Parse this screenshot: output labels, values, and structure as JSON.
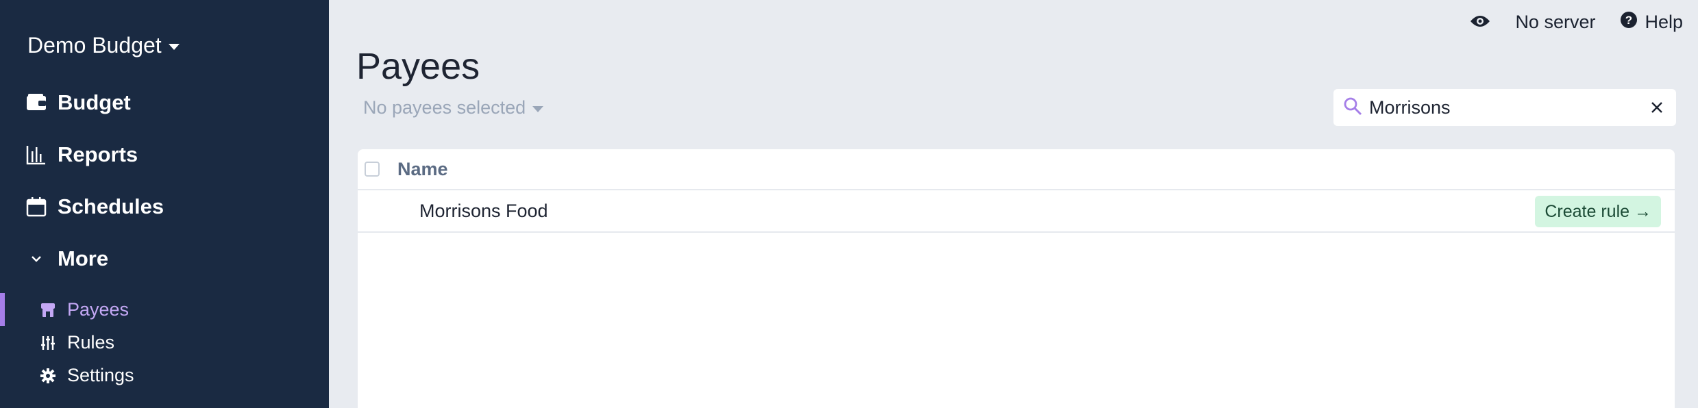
{
  "sidebar": {
    "budget_name": "Demo Budget",
    "nav": [
      {
        "label": "Budget",
        "icon": "wallet-icon"
      },
      {
        "label": "Reports",
        "icon": "bar-chart-icon"
      },
      {
        "label": "Schedules",
        "icon": "calendar-icon"
      },
      {
        "label": "More",
        "icon": "chevron-down-icon"
      }
    ],
    "sub": [
      {
        "label": "Payees",
        "icon": "store-icon",
        "active": true
      },
      {
        "label": "Rules",
        "icon": "sliders-icon"
      },
      {
        "label": "Settings",
        "icon": "gear-icon"
      }
    ]
  },
  "topbar": {
    "visibility_icon": "eye-icon",
    "server_label": "No server",
    "help_label": "Help"
  },
  "main": {
    "title": "Payees",
    "selection_label": "No payees selected",
    "search_value": "Morrisons",
    "table": {
      "header_name": "Name",
      "rows": [
        {
          "name": "Morrisons Food",
          "action": "Create rule →"
        }
      ]
    }
  },
  "colors": {
    "sidebar_bg": "#1a2a42",
    "accent": "#a57ee8",
    "rule_button_bg": "#d3f5e1"
  }
}
